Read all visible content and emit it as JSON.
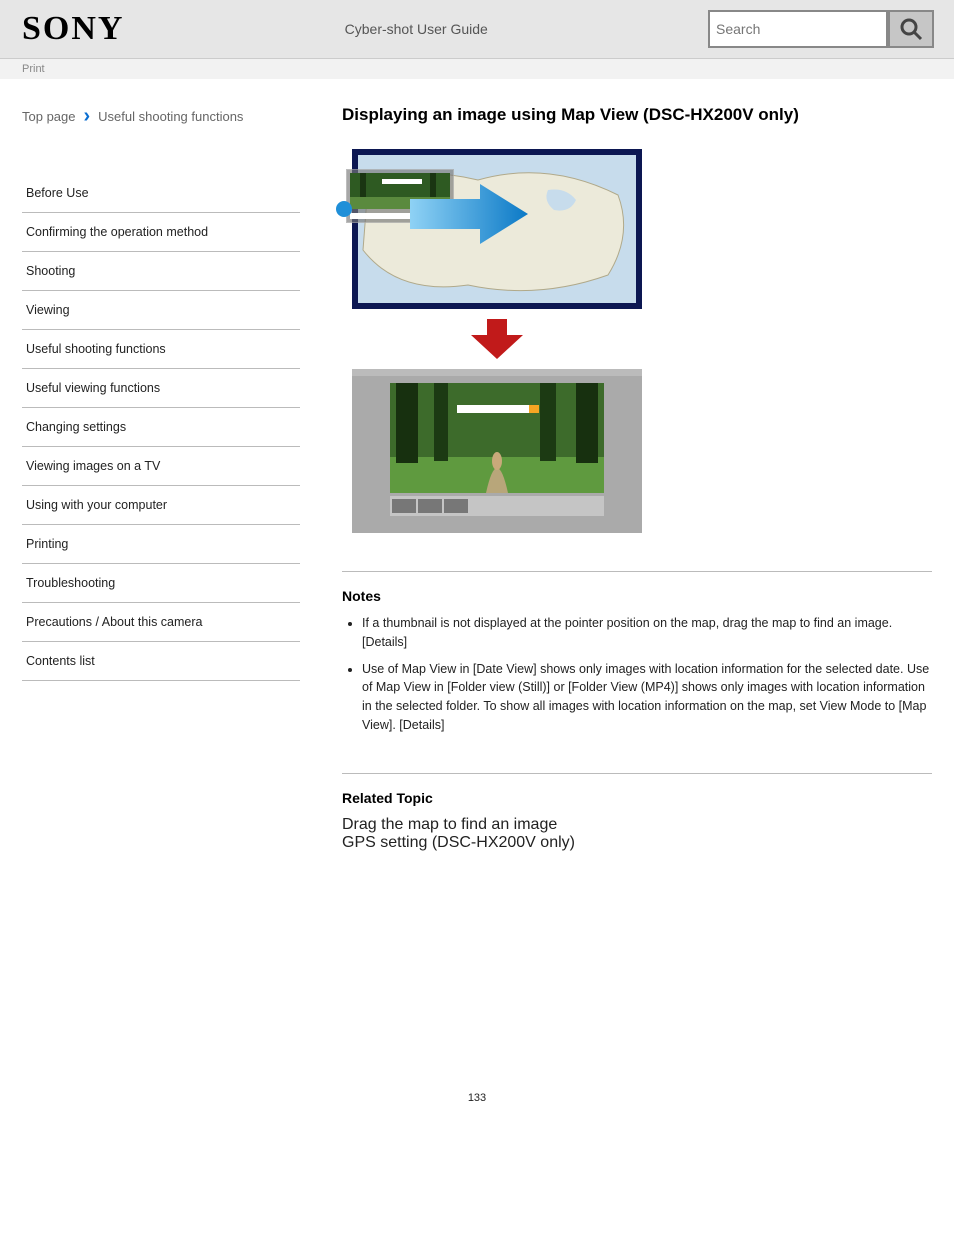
{
  "header": {
    "logo": "SONY",
    "doc_title": "Cyber-shot User Guide",
    "search_placeholder": "Search",
    "print_link": "Print"
  },
  "breadcrumb": {
    "top": "Top page",
    "section": "Useful shooting functions"
  },
  "sidebar": [
    "Before Use",
    "Confirming the operation method",
    "Shooting",
    "Viewing",
    "Useful shooting functions",
    "Useful viewing functions",
    "Changing settings",
    "Viewing images on a TV",
    "Using with your computer",
    "Printing",
    "Troubleshooting",
    "Precautions / About this camera",
    "Contents list"
  ],
  "main": {
    "title": "Displaying an image using Map View (DSC-HX200V only)",
    "notes_heading": "Notes",
    "notes": [
      "If a thumbnail is not displayed at the pointer position on the map, drag the map to find an image. [Details]",
      "Use of Map View in [Date View] shows only images with location information for the selected date. Use of Map View in [Folder view (Still)] or [Folder View (MP4)] shows only images with location information in the selected folder. To show all images with location information on the map, set View Mode to [Map View]. [Details]"
    ],
    "related_heading": "Related Topic",
    "related_links": [
      "Drag the map to find an image",
      "GPS setting (DSC-HX200V only)"
    ]
  },
  "page_number": "133"
}
